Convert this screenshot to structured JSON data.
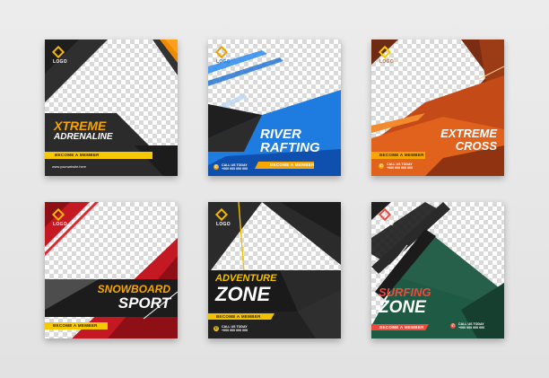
{
  "cards": [
    {
      "logo": "LOGO",
      "title": [
        "XTREME",
        "ADRENALINE"
      ],
      "cta": "BECOME A MEMBER",
      "website": "www.yourwebsite.here",
      "accent": "#f7a600"
    },
    {
      "logo": "LOGO",
      "title": [
        "RIVER",
        "RAFTING"
      ],
      "cta": "BECOME A MEMBER",
      "contact_label": "CALL US TODAY",
      "contact_number": "+000 000 000 000",
      "accent": "#1e7be0"
    },
    {
      "logo": "LOGO",
      "title": [
        "EXTREME",
        "CROSS"
      ],
      "cta": "BECOME A MEMBER",
      "contact_label": "CALL US TODAY",
      "contact_number": "+000 000 000 000",
      "accent": "#e2561b"
    },
    {
      "logo": "LOGO",
      "title": [
        "SNOWBOARD",
        "SPORT"
      ],
      "cta": "BECOME A MEMBER",
      "accent": "#d71e2b"
    },
    {
      "logo": "LOGO",
      "title": [
        "ADVENTURE",
        "ZONE"
      ],
      "cta": "BECOME A MEMBER",
      "contact_label": "CALL US TODAY",
      "contact_number": "+000 000 000 000",
      "accent": "#f2c200"
    },
    {
      "logo": "LOGO",
      "title": [
        "SURFING",
        "ZONE"
      ],
      "cta": "BECOME A MEMBER",
      "contact_label": "CALL US TODAY",
      "contact_number": "+000 000 000 000",
      "accent": "#ef4a3c"
    }
  ]
}
